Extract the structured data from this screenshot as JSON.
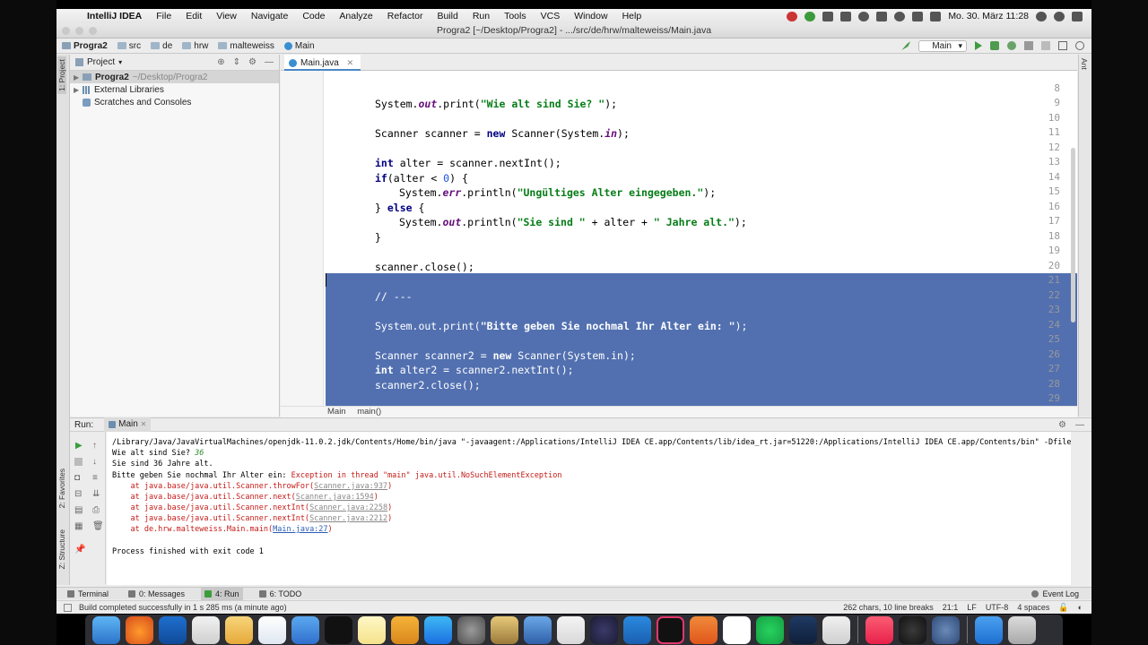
{
  "menubar": {
    "app_name": "IntelliJ IDEA",
    "items": [
      "File",
      "Edit",
      "View",
      "Navigate",
      "Code",
      "Analyze",
      "Refactor",
      "Build",
      "Run",
      "Tools",
      "VCS",
      "Window",
      "Help"
    ],
    "clock": "Mo. 30. März  11:28"
  },
  "window": {
    "title": "Progra2 [~/Desktop/Progra2] - .../src/de/hrw/malteweiss/Main.java"
  },
  "navbar": {
    "breadcrumbs": [
      "Progra2",
      "src",
      "de",
      "hrw",
      "malteweiss",
      "Main"
    ],
    "run_config": "Main"
  },
  "project_panel": {
    "title": "Project",
    "tree": [
      {
        "name": "Progra2",
        "path": "~/Desktop/Progra2"
      },
      {
        "name": "External Libraries"
      },
      {
        "name": "Scratches and Consoles"
      }
    ]
  },
  "side_tabs": {
    "project": "1: Project",
    "favorites": "2: Favorites",
    "structure": "Z: Structure",
    "ant": "Ant"
  },
  "editor": {
    "tab": "Main.java",
    "lines": [
      {
        "n": "8",
        "text": ""
      },
      {
        "n": "9",
        "text": ""
      },
      {
        "n": "10",
        "text": ""
      },
      {
        "n": "11",
        "text": ""
      },
      {
        "n": "12",
        "text": ""
      },
      {
        "n": "13",
        "text": ""
      },
      {
        "n": "14",
        "text": ""
      },
      {
        "n": "15",
        "text": ""
      },
      {
        "n": "16",
        "text": ""
      },
      {
        "n": "17",
        "text": ""
      },
      {
        "n": "18",
        "text": ""
      },
      {
        "n": "19",
        "text": ""
      },
      {
        "n": "20",
        "text": ""
      },
      {
        "n": "21",
        "text": ""
      },
      {
        "n": "22",
        "text": ""
      },
      {
        "n": "23",
        "text": ""
      },
      {
        "n": "24",
        "text": ""
      },
      {
        "n": "25",
        "text": ""
      },
      {
        "n": "26",
        "text": ""
      },
      {
        "n": "27",
        "text": ""
      },
      {
        "n": "28",
        "text": ""
      },
      {
        "n": "29",
        "text": ""
      }
    ],
    "code": {
      "l9_a": "System.",
      "l9_b": "out",
      "l9_c": ".print(",
      "l9_d": "\"Wie alt sind Sie? \"",
      "l9_e": ");",
      "l11_a": "Scanner scanner = ",
      "l11_b": "new",
      "l11_c": " Scanner(System.",
      "l11_d": "in",
      "l11_e": ");",
      "l13_a": "int",
      "l13_b": " alter = scanner.nextInt();",
      "l14_a": "if",
      "l14_b": "(alter < ",
      "l14_c": "0",
      "l14_d": ") {",
      "l15_a": "System.",
      "l15_b": "err",
      "l15_c": ".println(",
      "l15_d": "\"Ungültiges Alter eingegeben.\"",
      "l15_e": ");",
      "l16_a": "} ",
      "l16_b": "else",
      "l16_c": " {",
      "l17_a": "System.",
      "l17_b": "out",
      "l17_c": ".println(",
      "l17_d": "\"Sie sind \"",
      "l17_e": " + alter + ",
      "l17_f": "\" Jahre alt.\"",
      "l17_g": ");",
      "l18": "}",
      "l20": "scanner.close();",
      "l22": "// ---",
      "l24_a": "System.out.print(",
      "l24_b": "\"Bitte geben Sie nochmal Ihr Alter ein: \"",
      "l24_c": ");",
      "l26_a": "Scanner scanner2 = ",
      "l26_b": "new",
      "l26_c": " Scanner(System.in);",
      "l27_a": "int",
      "l27_b": " alter2 = scanner2.nextInt();",
      "l28": "scanner2.close();"
    },
    "breadcrumb": [
      "Main",
      "main()"
    ]
  },
  "run_panel": {
    "label": "Run:",
    "tab": "Main",
    "console": {
      "cmd": "/Library/Java/JavaVirtualMachines/openjdk-11.0.2.jdk/Contents/Home/bin/java \"-javaagent:/Applications/IntelliJ IDEA CE.app/Contents/lib/idea_rt.jar=51220:/Applications/IntelliJ IDEA CE.app/Contents/bin\" -Dfile.encoding=UTF-",
      "q1": "Wie alt sind Sie? ",
      "q1_input": "36",
      "out2": "Sie sind 36 Jahre alt.",
      "q2": "Bitte geben Sie nochmal Ihr Alter ein: ",
      "exc": "Exception in thread \"main\" java.util.NoSuchElementException",
      "st1_a": "    at java.base/java.util.Scanner.throwFor(",
      "st1_b": "Scanner.java:937",
      "st1_c": ")",
      "st2_a": "    at java.base/java.util.Scanner.next(",
      "st2_b": "Scanner.java:1594",
      "st2_c": ")",
      "st3_a": "    at java.base/java.util.Scanner.nextInt(",
      "st3_b": "Scanner.java:2258",
      "st3_c": ")",
      "st4_a": "    at java.base/java.util.Scanner.nextInt(",
      "st4_b": "Scanner.java:2212",
      "st4_c": ")",
      "st5_a": "    at de.hrw.malteweiss.Main.main(",
      "st5_b": "Main.java:27",
      "st5_c": ")",
      "exit": "Process finished with exit code 1"
    }
  },
  "bottom_tools": {
    "terminal": "Terminal",
    "messages": "0: Messages",
    "run": "4: Run",
    "todo": "6: TODO",
    "event_log": "Event Log"
  },
  "status": {
    "message": "Build completed successfully in 1 s 285 ms (a minute ago)",
    "chars": "262 chars, 10 line breaks",
    "position": "21:1",
    "line_sep": "LF",
    "encoding": "UTF-8",
    "indent": "4 spaces"
  },
  "colors": {
    "selection": "#5270b0",
    "keyword": "#000080",
    "string": "#067d17",
    "error": "#c41a16"
  }
}
